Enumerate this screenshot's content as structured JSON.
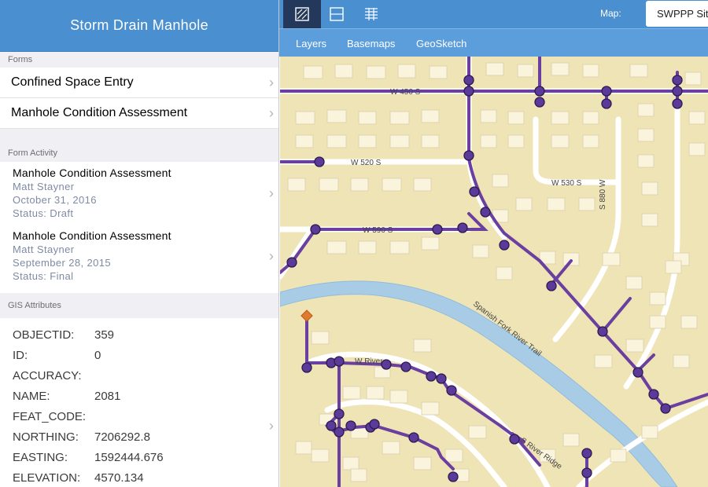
{
  "sidebar": {
    "title": "Storm Drain Manhole",
    "forms_label": "Forms",
    "forms": [
      "Confined Space Entry",
      "Manhole Condition Assessment"
    ],
    "activity_label": "Form Activity",
    "activity": [
      {
        "title": "Manhole Condition Assessment",
        "user": "Matt Stayner",
        "date": "October 31, 2016",
        "status": "Status: Draft"
      },
      {
        "title": "Manhole Condition Assessment",
        "user": "Matt Stayner",
        "date": "September 28, 2015",
        "status": "Status: Final"
      }
    ],
    "gis_label": "GIS Attributes",
    "gis": [
      {
        "key": "OBJECTID:",
        "value": "359"
      },
      {
        "key": "ID:",
        "value": "0"
      },
      {
        "key": "ACCURACY:",
        "value": ""
      },
      {
        "key": "NAME:",
        "value": "2081"
      },
      {
        "key": "FEAT_CODE:",
        "value": ""
      },
      {
        "key": "NORTHING:",
        "value": "7206292.8"
      },
      {
        "key": "EASTING:",
        "value": "1592444.676"
      },
      {
        "key": "ELEVATION:",
        "value": "4570.134"
      }
    ],
    "chevron": "›"
  },
  "toolbar": {
    "tools": [
      "map-tool-icon",
      "layout-tool-icon",
      "list-tool-icon"
    ],
    "map_label": "Map:",
    "map_value": "SWPPP Sit"
  },
  "subnav": {
    "items": [
      "Layers",
      "Basemaps",
      "GeoSketch"
    ]
  },
  "map": {
    "street_labels": [
      "W 450 S",
      "W 520 S",
      "W 530 S",
      "S 880 W",
      "W 590 S",
      "Spanish Fork River Trail",
      "W River",
      "S River Ridge"
    ],
    "colors": {
      "base": "#efe4b6",
      "road": "#ffffff",
      "river": "#a9cce6",
      "pipe": "#6a3fa0",
      "node": "#5b3a99",
      "selected": "#e07a2e"
    }
  }
}
